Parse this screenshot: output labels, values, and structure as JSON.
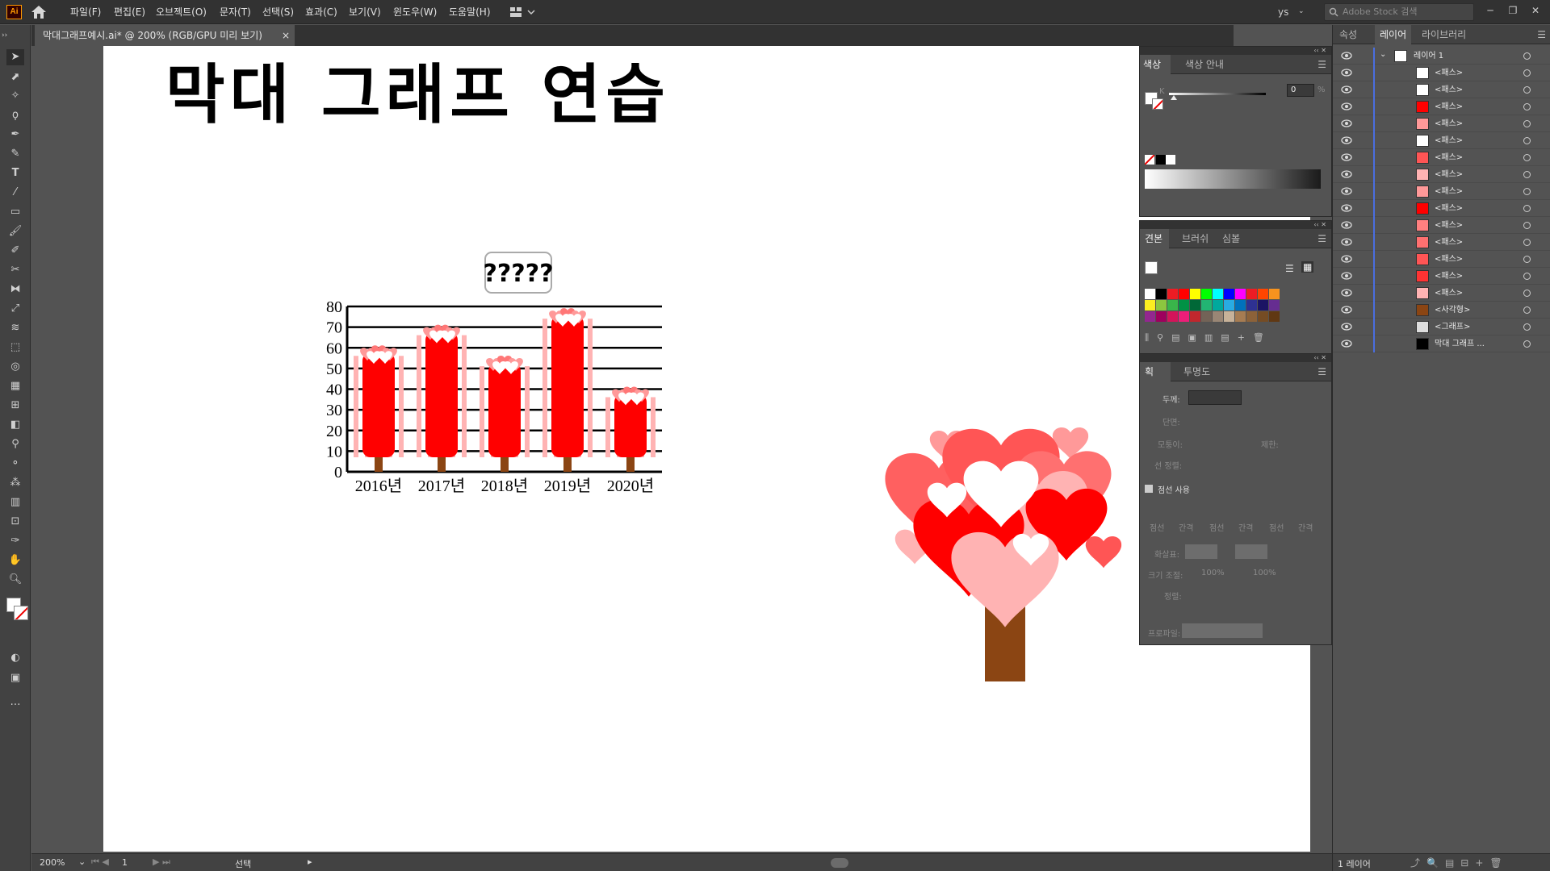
{
  "app": {
    "logo": "Ai",
    "user": "ys",
    "search_placeholder": "Adobe Stock 검색"
  },
  "menu": [
    "파일(F)",
    "편집(E)",
    "오브젝트(O)",
    "문자(T)",
    "선택(S)",
    "효과(C)",
    "보기(V)",
    "윈도우(W)",
    "도움말(H)"
  ],
  "document": {
    "tab_label": "막대그래프예시.ai* @ 200% (RGB/GPU 미리 보기)",
    "close": "×"
  },
  "artwork": {
    "title": "막대 그래프 연습",
    "chart_badge": "?????"
  },
  "chart_data": {
    "type": "bar",
    "categories": [
      "2016년",
      "2017년",
      "2018년",
      "2019년",
      "2020년"
    ],
    "values": [
      60,
      70,
      55,
      78,
      40
    ],
    "ylim": [
      0,
      80
    ],
    "yticks": [
      0,
      10,
      20,
      30,
      40,
      50,
      60,
      70,
      80
    ],
    "grid": true,
    "colors": {
      "bar": "#ff0000",
      "bar_shadow": "#ffb3b3",
      "heart": "#ff9999",
      "trunk": "#8b4513"
    }
  },
  "color_panel": {
    "tabs": [
      "색상",
      "색상 안내"
    ],
    "channel": "K",
    "value": "0",
    "unit": "%"
  },
  "swatches_panel": {
    "tabs": [
      "견본",
      "브러쉬",
      "심볼"
    ],
    "colors": [
      "#ffffff",
      "#000000",
      "#ed1c24",
      "#ff0000",
      "#ffff00",
      "#00ff00",
      "#00ffff",
      "#0000ff",
      "#ff00ff",
      "#ed1c24",
      "#ff4500",
      "#f7931e",
      "#fcee21",
      "#8cc63f",
      "#39b54a",
      "#009245",
      "#006837",
      "#22b573",
      "#00a99d",
      "#29abe2",
      "#0071bc",
      "#2e3192",
      "#1b1464",
      "#662d91",
      "#93278f",
      "#9e005d",
      "#d4145a",
      "#ed1e79",
      "#c1272d",
      "#736357",
      "#998675",
      "#c7b299",
      "#a67c52",
      "#8c6239",
      "#754c24",
      "#603813"
    ]
  },
  "stroke_panel": {
    "tabs": [
      "획",
      "투명도"
    ],
    "weight_label": "두께:",
    "cap_label": "단면:",
    "corner_label": "모퉁이:",
    "limit_label": "제한:",
    "align_label": "선 정렬:",
    "dashed_label": "점선 사용",
    "dash_labels": [
      "점선",
      "간격",
      "점선",
      "간격",
      "점선",
      "간격"
    ],
    "arrow_label": "화살표:",
    "scale_label": "크기 조절:",
    "scale_values": [
      "100%",
      "100%"
    ],
    "align2_label": "정렬:",
    "profile_label": "프로파일:"
  },
  "layers_panel": {
    "tabs": [
      "속성",
      "레이어",
      "라이브러리"
    ],
    "layers": [
      {
        "name": "레이어 1",
        "thumb": "#ffffff",
        "level": 0
      },
      {
        "name": "<패스>",
        "thumb": "#ffffff",
        "level": 1
      },
      {
        "name": "<패스>",
        "thumb": "#ffffff",
        "level": 1
      },
      {
        "name": "<패스>",
        "thumb": "#ff0000",
        "level": 1
      },
      {
        "name": "<패스>",
        "thumb": "#ff9999",
        "level": 1
      },
      {
        "name": "<패스>",
        "thumb": "#ffffff",
        "level": 1
      },
      {
        "name": "<패스>",
        "thumb": "#ff5555",
        "level": 1
      },
      {
        "name": "<패스>",
        "thumb": "#ffb3b3",
        "level": 1
      },
      {
        "name": "<패스>",
        "thumb": "#ff9999",
        "level": 1
      },
      {
        "name": "<패스>",
        "thumb": "#ff0000",
        "level": 1
      },
      {
        "name": "<패스>",
        "thumb": "#ff8080",
        "level": 1
      },
      {
        "name": "<패스>",
        "thumb": "#ff7070",
        "level": 1
      },
      {
        "name": "<패스>",
        "thumb": "#ff5555",
        "level": 1
      },
      {
        "name": "<패스>",
        "thumb": "#ff3333",
        "level": 1
      },
      {
        "name": "<패스>",
        "thumb": "#ffb3b3",
        "level": 1
      },
      {
        "name": "<사각형>",
        "thumb": "#8b4513",
        "level": 1
      },
      {
        "name": "<그래프>",
        "thumb": "#dddddd",
        "level": 1
      },
      {
        "name": "막대 그래프 ...",
        "thumb": "#000000",
        "level": 1
      }
    ],
    "footer": "1 레이어"
  },
  "status": {
    "zoom": "200%",
    "artboard": "1",
    "tool": "선택"
  }
}
